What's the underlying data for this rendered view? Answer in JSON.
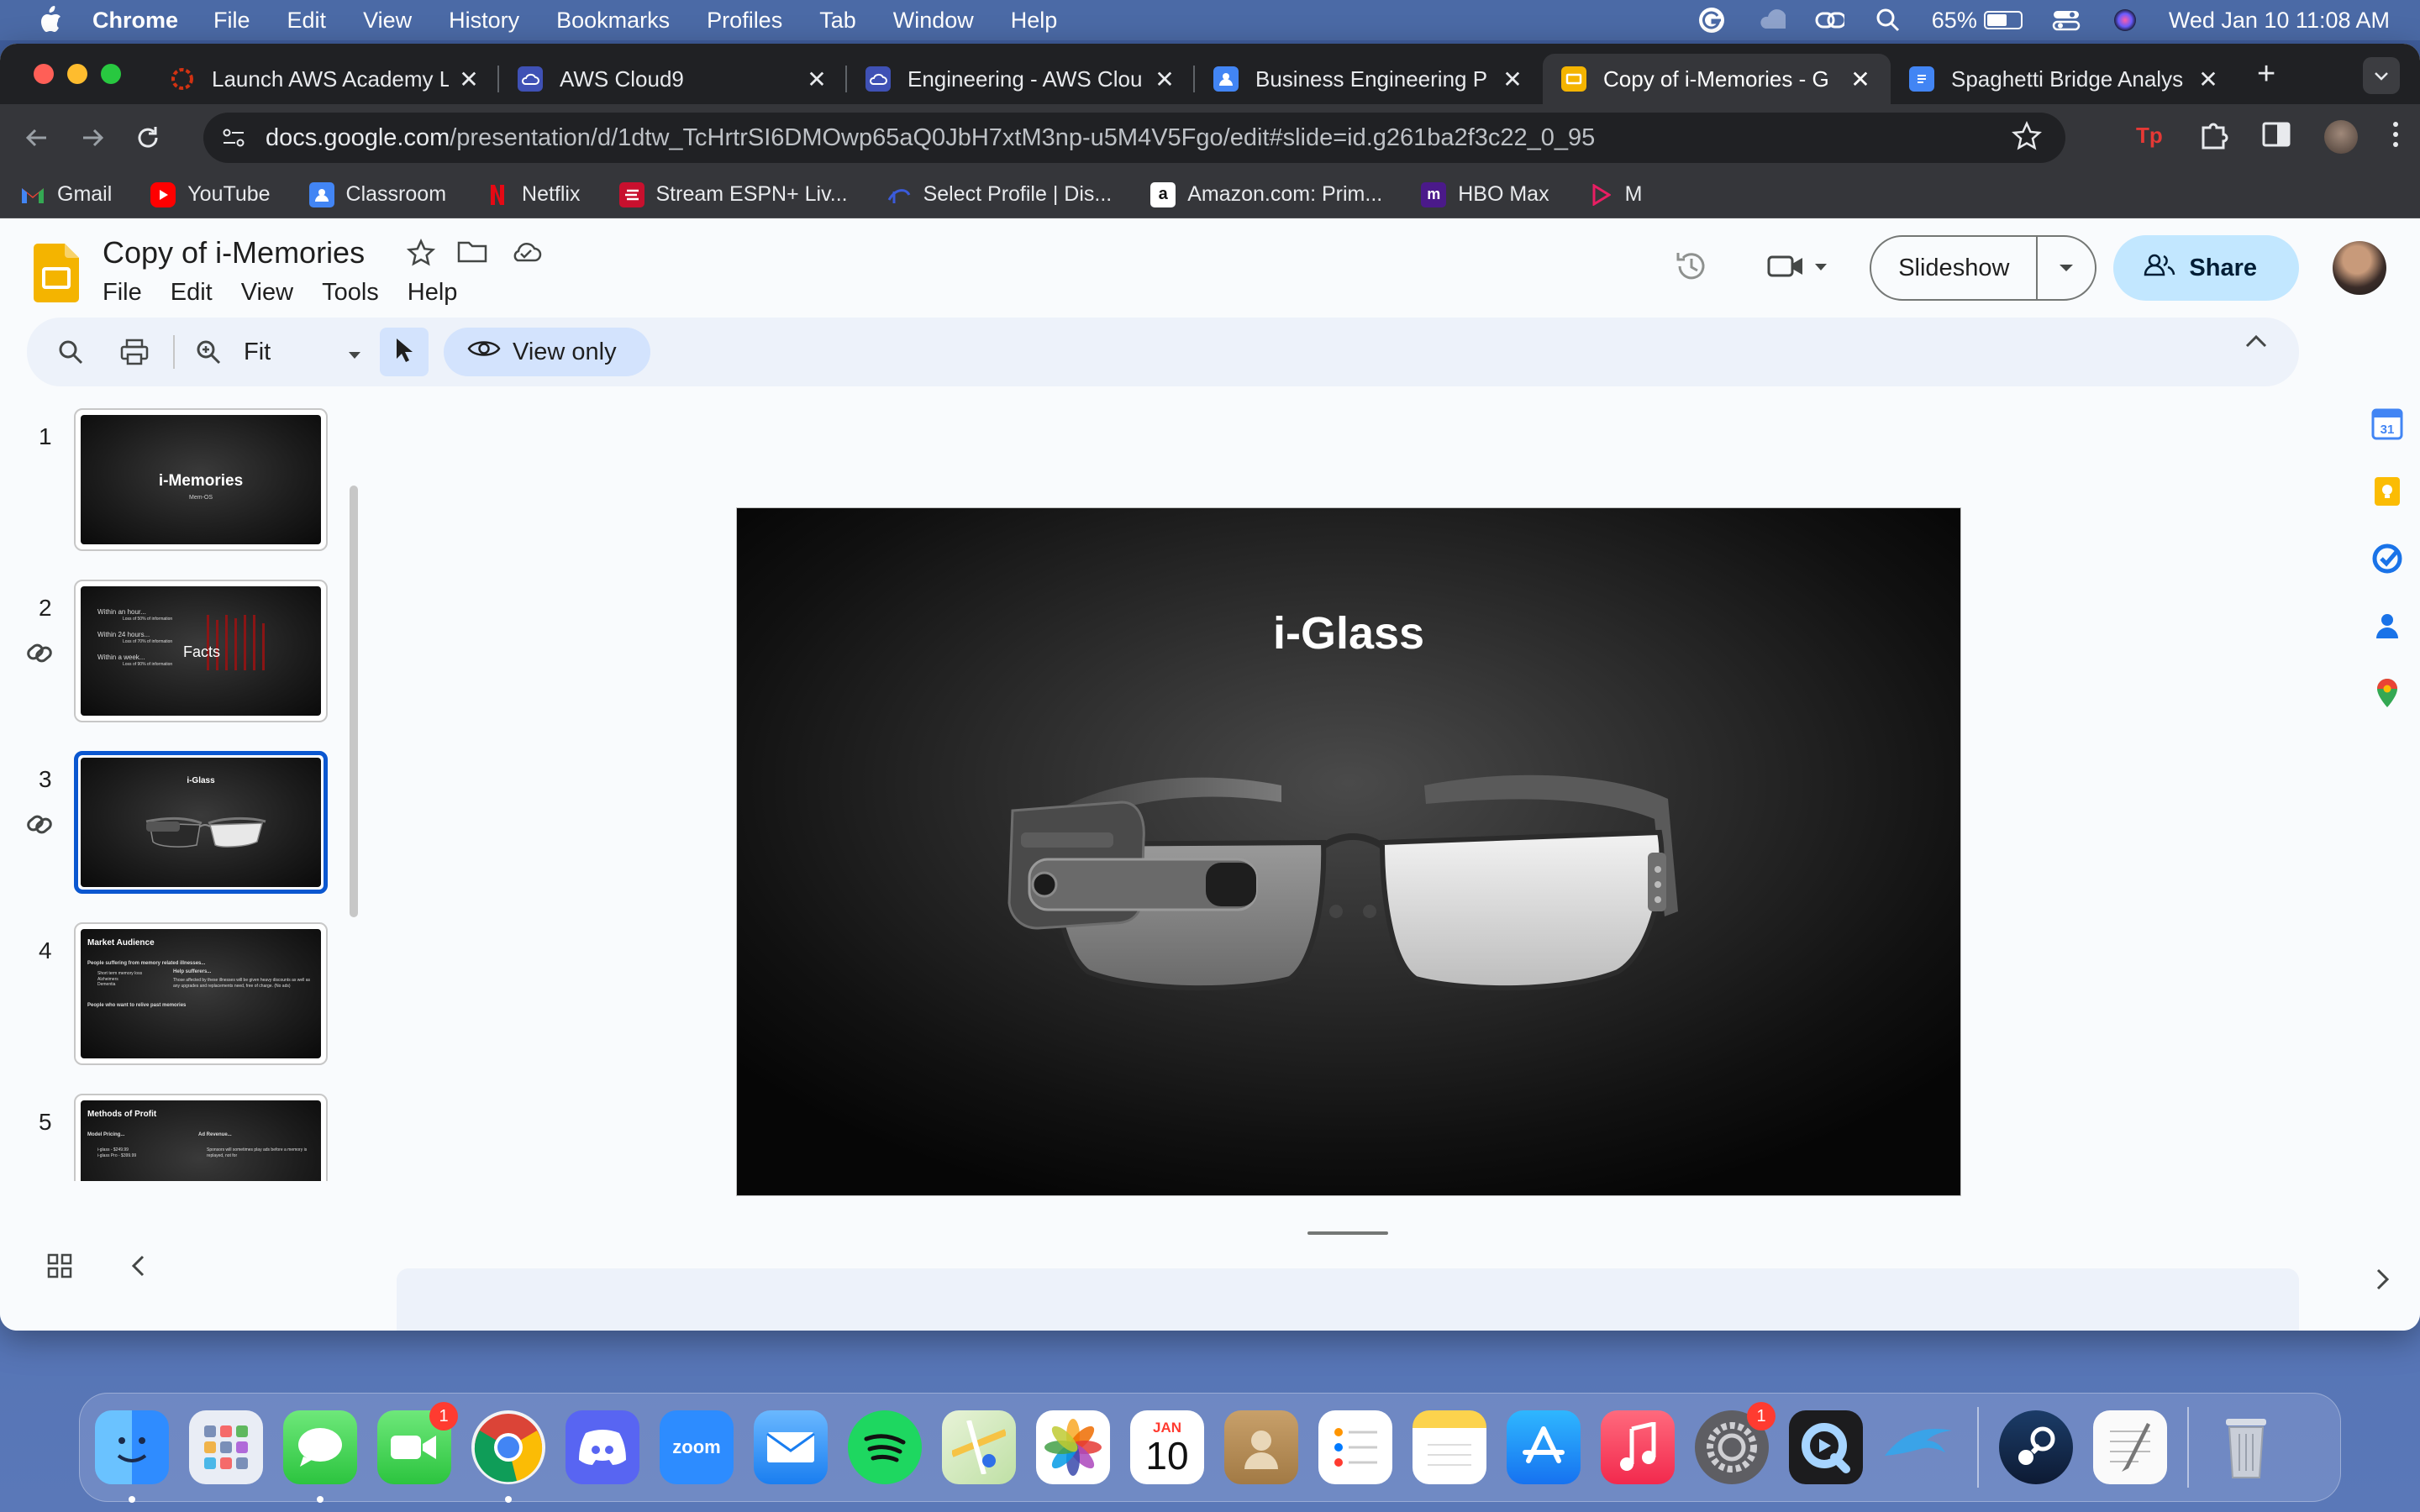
{
  "menubar": {
    "app_name": "Chrome",
    "items": [
      "File",
      "Edit",
      "View",
      "History",
      "Bookmarks",
      "Profiles",
      "Tab",
      "Window",
      "Help"
    ],
    "battery_percent": "65%",
    "battery_level": 0.65,
    "datetime": "Wed Jan 10  11:08 AM"
  },
  "tabs": [
    {
      "title": "Launch AWS Academy L",
      "icon": "aws-academy-icon",
      "active": false
    },
    {
      "title": "AWS Cloud9",
      "icon": "cloud9-icon",
      "active": false
    },
    {
      "title": "Engineering - AWS Clou",
      "icon": "cloud9-icon",
      "active": false
    },
    {
      "title": "Business Engineering P",
      "icon": "classroom-icon",
      "active": false
    },
    {
      "title": "Copy of i-Memories - G",
      "icon": "slides-icon",
      "active": true
    },
    {
      "title": "Spaghetti Bridge Analys",
      "icon": "docs-icon",
      "active": false
    }
  ],
  "omnibox": {
    "host": "docs.google.com",
    "path": "/presentation/d/1dtw_TcHrtrSI6DMOwp65aQ0JbH7xtM3np-u5M4V5Fgo/edit#slide=id.g261ba2f3c22_0_95"
  },
  "bookmarks": [
    {
      "label": "Gmail",
      "icon": "gmail-icon"
    },
    {
      "label": "YouTube",
      "icon": "youtube-icon"
    },
    {
      "label": "Classroom",
      "icon": "classroom-icon"
    },
    {
      "label": "Netflix",
      "icon": "netflix-icon"
    },
    {
      "label": "Stream ESPN+ Liv...",
      "icon": "espn-icon"
    },
    {
      "label": "Select Profile | Dis...",
      "icon": "disney-icon"
    },
    {
      "label": "Amazon.com: Prim...",
      "icon": "amazon-icon"
    },
    {
      "label": "HBO Max",
      "icon": "hbo-icon"
    },
    {
      "label": "M",
      "icon": "play-icon"
    }
  ],
  "doc": {
    "title": "Copy of i-Memories",
    "menu": [
      "File",
      "Edit",
      "View",
      "Tools",
      "Help"
    ],
    "slideshow_label": "Slideshow",
    "share_label": "Share"
  },
  "edit_toolbar": {
    "zoom": "Fit",
    "view_only": "View only"
  },
  "slides": [
    {
      "num": "1",
      "title": "i-Memories",
      "subtitle": "Mem-OS",
      "linked": false
    },
    {
      "num": "2",
      "title": "Facts",
      "lines": [
        "Within an hour...",
        "Loss of 50% of information",
        "Within 24 hours...",
        "Loss of 70% of information",
        "Within a week...",
        "Loss of 90% of information"
      ],
      "linked": true
    },
    {
      "num": "3",
      "title": "i-Glass",
      "linked": true,
      "active": true
    },
    {
      "num": "4",
      "title": "Market Audience",
      "lines": [
        "People suffering from memory related illnesses...",
        "Short term memory loss",
        "Alzheimers",
        "Dementia",
        "Help sufferers...",
        "Those affected by these illnesses will be given heavy discounts as well as any upgrades and replacements need, free of charge. (No ads)",
        "People who want to relive past memories"
      ],
      "linked": false
    },
    {
      "num": "5",
      "title": "Methods of Profit",
      "lines": [
        "Model Pricing...",
        "i-glass - $249.99",
        "i-glass Pro - $399.99",
        "Ad Revenue...",
        "Sponsors will sometimes play ads before a memory is replayed, not for"
      ],
      "linked": false
    }
  ],
  "current_slide": {
    "title": "i-Glass"
  },
  "dock": {
    "apps": [
      {
        "name": "Finder",
        "icon": "finder-icon",
        "running": true
      },
      {
        "name": "Launchpad",
        "icon": "launchpad-icon"
      },
      {
        "name": "Messages",
        "icon": "messages-icon",
        "running": true
      },
      {
        "name": "FaceTime",
        "icon": "facetime-icon",
        "badge": "1"
      },
      {
        "name": "Google Chrome",
        "icon": "chrome-icon",
        "running": true
      },
      {
        "name": "Discord",
        "icon": "discord-icon"
      },
      {
        "name": "Zoom",
        "icon": "zoom-icon",
        "label": "zoom"
      },
      {
        "name": "Mail",
        "icon": "mail-icon"
      },
      {
        "name": "Spotify",
        "icon": "spotify-icon"
      },
      {
        "name": "Maps",
        "icon": "maps-icon"
      },
      {
        "name": "Photos",
        "icon": "photos-icon"
      },
      {
        "name": "Calendar",
        "icon": "calendar-icon",
        "month": "JAN",
        "day": "10"
      },
      {
        "name": "Contacts",
        "icon": "contacts-icon"
      },
      {
        "name": "Reminders",
        "icon": "reminders-icon"
      },
      {
        "name": "Notes",
        "icon": "notes-icon"
      },
      {
        "name": "App Store",
        "icon": "app-store-icon"
      },
      {
        "name": "Music",
        "icon": "music-icon"
      },
      {
        "name": "System Settings",
        "icon": "settings-icon",
        "badge": "1"
      },
      {
        "name": "QuickTime Player",
        "icon": "quicktime-icon"
      },
      {
        "name": "Dolphin",
        "icon": "dolphin-icon"
      },
      {
        "name": "Steam",
        "icon": "steam-icon"
      },
      {
        "name": "TextEdit",
        "icon": "textedit-icon"
      },
      {
        "name": "Trash",
        "icon": "trash-icon"
      }
    ]
  },
  "colors": {
    "accent_blue": "#0b57d0",
    "share_bg": "#c2e7ff",
    "toolbar_bg": "#edf2fa",
    "chrome_dark": "#202124"
  }
}
